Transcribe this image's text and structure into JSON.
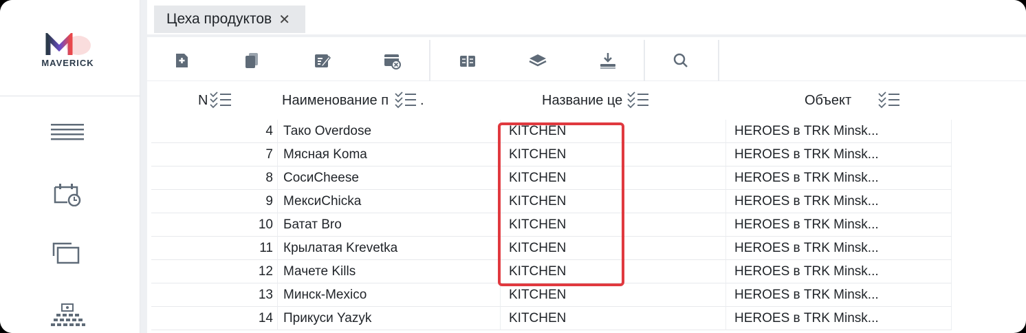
{
  "app": {
    "brand": "MAVERICK",
    "logo_letter": "M"
  },
  "sidebar": {
    "items": [
      {
        "icon": "hamburger-menu-icon"
      },
      {
        "icon": "calendar-clock-icon"
      },
      {
        "icon": "windows-icon"
      },
      {
        "icon": "hierarchy-icon"
      }
    ]
  },
  "tabs": [
    {
      "label": "Цеха продуктов",
      "close": "✕"
    }
  ],
  "toolbar": {
    "buttons": [
      "add-document-icon",
      "copy-icon",
      "edit-icon",
      "delete-card-icon",
      "columns-icon",
      "layers-icon",
      "import-icon",
      "search-icon"
    ]
  },
  "grid": {
    "columns": [
      {
        "label": "N"
      },
      {
        "label": "Наименование п"
      },
      {
        "label": "Название це"
      },
      {
        "label": "Объект"
      }
    ],
    "rows": [
      {
        "n": "4",
        "name": "Тако Overdose",
        "shop": "KITCHEN",
        "object": "HEROES в TRK Minsk..."
      },
      {
        "n": "7",
        "name": "Мясная Koma",
        "shop": "KITCHEN",
        "object": "HEROES в TRK Minsk..."
      },
      {
        "n": "8",
        "name": "СосиCheese",
        "shop": "KITCHEN",
        "object": "HEROES в TRK Minsk..."
      },
      {
        "n": "9",
        "name": "МексиChicka",
        "shop": "KITCHEN",
        "object": "HEROES в TRK Minsk..."
      },
      {
        "n": "10",
        "name": "Батат Bro",
        "shop": "KITCHEN",
        "object": "HEROES в TRK Minsk..."
      },
      {
        "n": "11",
        "name": "Крылатая Krevetka",
        "shop": "KITCHEN",
        "object": "HEROES в TRK Minsk..."
      },
      {
        "n": "12",
        "name": "Мачете Kills",
        "shop": "KITCHEN",
        "object": "HEROES в TRK Minsk..."
      },
      {
        "n": "13",
        "name": "Минск-Mexico",
        "shop": "KITCHEN",
        "object": "HEROES в TRK Minsk..."
      },
      {
        "n": "14",
        "name": "Прикуси Yazyk",
        "shop": "KITCHEN",
        "object": "HEROES в TRK Minsk..."
      }
    ]
  },
  "colors": {
    "accent_red": "#e0393f",
    "icon_gray": "#5f6b78",
    "logo_purple": "#6b4cc9",
    "logo_red": "#e8484b"
  }
}
